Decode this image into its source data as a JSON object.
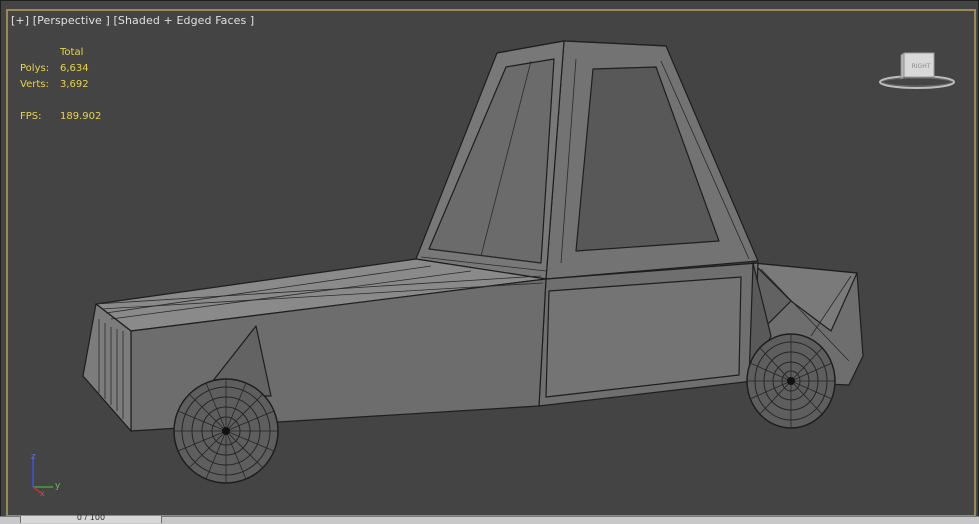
{
  "viewport": {
    "menu_label": "[+]",
    "view_label": "[Perspective ]",
    "shading_label": "[Shaded + Edged Faces ]"
  },
  "stats": {
    "header": "Total",
    "polys_label": "Polys:",
    "polys_value": "6,634",
    "verts_label": "Verts:",
    "verts_value": "3,692",
    "fps_label": "FPS:",
    "fps_value": "189.902"
  },
  "viewcube": {
    "face_label": "RIGHT",
    "icon": "viewcube-icon"
  },
  "axis_tripod": {
    "x": "x",
    "y": "y",
    "z": "z"
  },
  "timeslider": {
    "label": "0 / 100"
  },
  "colors": {
    "viewport_bg": "#444444",
    "stats_text": "#e8d44a",
    "model_fill": "#6f6f6f",
    "wire": "#1e1e1e",
    "frame_highlight": "#9a8a55"
  }
}
